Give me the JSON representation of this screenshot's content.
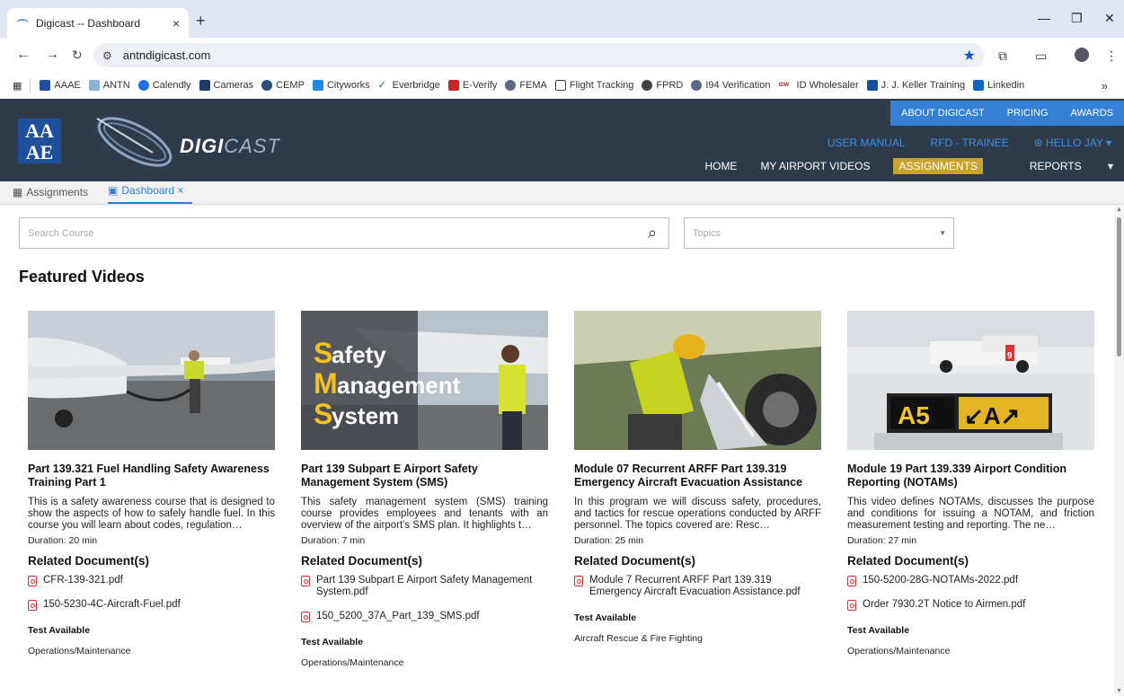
{
  "browser": {
    "tab_title": "Digicast -- Dashboard",
    "url": "antndigicast.com",
    "bookmarks": [
      "AAAE",
      "ANTN",
      "Calendly",
      "Cameras",
      "CEMP",
      "Cityworks",
      "Everbridge",
      "E-Verify",
      "FEMA",
      "Flight Tracking",
      "FPRD",
      "I94 Verification",
      "ID Wholesaler",
      "J. J. Keller Training",
      "Linkedin"
    ],
    "bookmark_more": "»"
  },
  "header": {
    "logo_text": "AA\nAE",
    "brand_bold": "DIGI",
    "brand_light": "CAST",
    "top_links": [
      "ABOUT DIGICAST",
      "PRICING",
      "AWARDS"
    ],
    "util_links": [
      "USER MANUAL",
      "RFD - TRAINEE",
      "HELLO JAY"
    ],
    "nav": [
      "HOME",
      "MY AIRPORT VIDEOS",
      "ASSIGNMENTS",
      "REPORTS"
    ]
  },
  "app_tabs": [
    {
      "label": "Assignments"
    },
    {
      "label": "Dashboard ×"
    }
  ],
  "search": {
    "placeholder": "Search Course",
    "topics_placeholder": "Topics"
  },
  "featured_title": "Featured Videos",
  "cards": [
    {
      "title": "Part 139.321 Fuel Handling Safety Awareness Training Part 1",
      "desc": "This is a safety awareness course that is designed to show the aspects of how to safely handle fuel. In this course you will learn about codes, regulation…",
      "duration": "Duration: 20 min",
      "related": "Related Document(s)",
      "docs": [
        "CFR-139-321.pdf",
        "150-5230-4C-Aircraft-Fuel.pdf"
      ],
      "test": "Test Available",
      "category": "Operations/Maintenance"
    },
    {
      "title": "Part 139 Subpart E Airport Safety Management System (SMS)",
      "desc": "This safety management system (SMS) training course provides employees and tenants with an overview of the airport's SMS plan. It highlights t…",
      "duration": "Duration: 7 min",
      "related": "Related Document(s)",
      "docs": [
        "Part 139 Subpart E Airport Safety Management System.pdf",
        "150_5200_37A_Part_139_SMS.pdf"
      ],
      "test": "Test Available",
      "category": "Operations/Maintenance",
      "thumb_text": [
        "S",
        "afety",
        "M",
        "anagement",
        "S",
        "ystem"
      ]
    },
    {
      "title": "Module 07 Recurrent ARFF Part 139.319 Emergency Aircraft Evacuation Assistance",
      "desc": "In this program we will discuss safety, procedures, and tactics for rescue operations conducted by ARFF personnel. The topics covered are: Resc…",
      "duration": "Duration: 25 min",
      "related": "Related Document(s)",
      "docs": [
        "Module 7 Recurrent ARFF Part 139.319 Emergency Aircraft Evacuation Assistance.pdf"
      ],
      "test": "Test Available",
      "category": "Aircraft Rescue & Fire Fighting"
    },
    {
      "title": "Module 19 Part 139.339 Airport Condition Reporting (NOTAMs)",
      "desc": "This video defines NOTAMs, discusses the purpose and conditions for issuing a NOTAM, and friction measurement testing and reporting. The ne…",
      "duration": "Duration: 27 min",
      "related": "Related Document(s)",
      "docs": [
        "150-5200-28G-NOTAMs-2022.pdf",
        "Order 7930.2T Notice to Airmen.pdf"
      ],
      "test": "Test Available",
      "category": "Operations/Maintenance",
      "thumb_text": [
        "A5",
        "↙A↗",
        "9"
      ]
    }
  ]
}
